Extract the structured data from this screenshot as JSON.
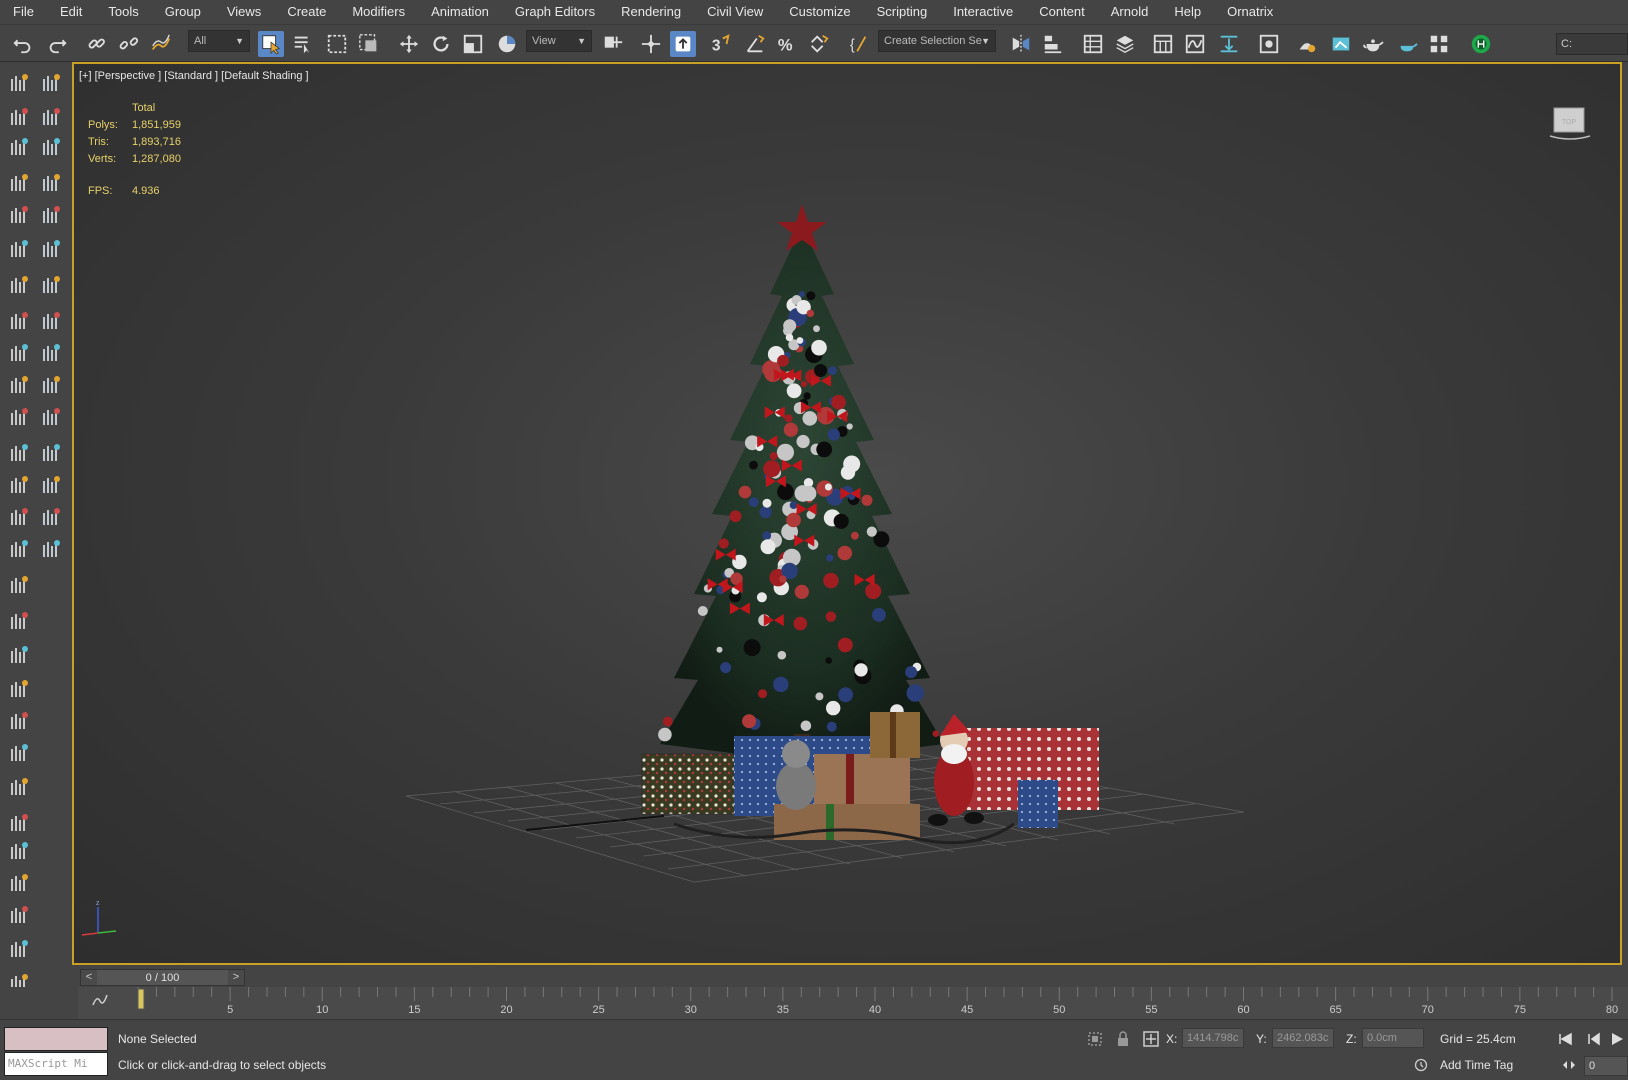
{
  "menu": [
    "File",
    "Edit",
    "Tools",
    "Group",
    "Views",
    "Create",
    "Modifiers",
    "Animation",
    "Graph Editors",
    "Rendering",
    "Civil View",
    "Customize",
    "Scripting",
    "Interactive",
    "Content",
    "Arnold",
    "Help",
    "Ornatrix"
  ],
  "toolbar": {
    "filter_value": "All",
    "refcoord_value": "View",
    "named_selection_value": "Create Selection Se",
    "right_edge_label": "C:"
  },
  "viewport": {
    "label": "[+] [Perspective ] [Standard ] [Default Shading ]",
    "stats": {
      "header": "Total",
      "polys_label": "Polys:",
      "polys": "1,851,959",
      "tris_label": "Tris:",
      "tris": "1,893,716",
      "verts_label": "Verts:",
      "verts": "1,287,080",
      "fps_label": "FPS:",
      "fps": "4.936"
    },
    "active_border_color": "#c9a225"
  },
  "timeline": {
    "slider_text": "0 / 100",
    "prev": "<",
    "next": ">",
    "ticks": [
      "5",
      "10",
      "15",
      "20",
      "25",
      "30",
      "35",
      "40",
      "45",
      "50",
      "55",
      "60",
      "65",
      "70",
      "75",
      "80"
    ]
  },
  "status": {
    "maxscript_placeholder": "MAXScript Mi",
    "selection": "None Selected",
    "prompt": "Click or click-and-drag to select objects",
    "x_label": "X:",
    "x": "1414.798c",
    "y_label": "Y:",
    "y": "2462.083c",
    "z_label": "Z:",
    "z": "0.0cm",
    "grid": "Grid = 25.4cm",
    "add_time_tag": "Add Time Tag",
    "frame": "0"
  }
}
